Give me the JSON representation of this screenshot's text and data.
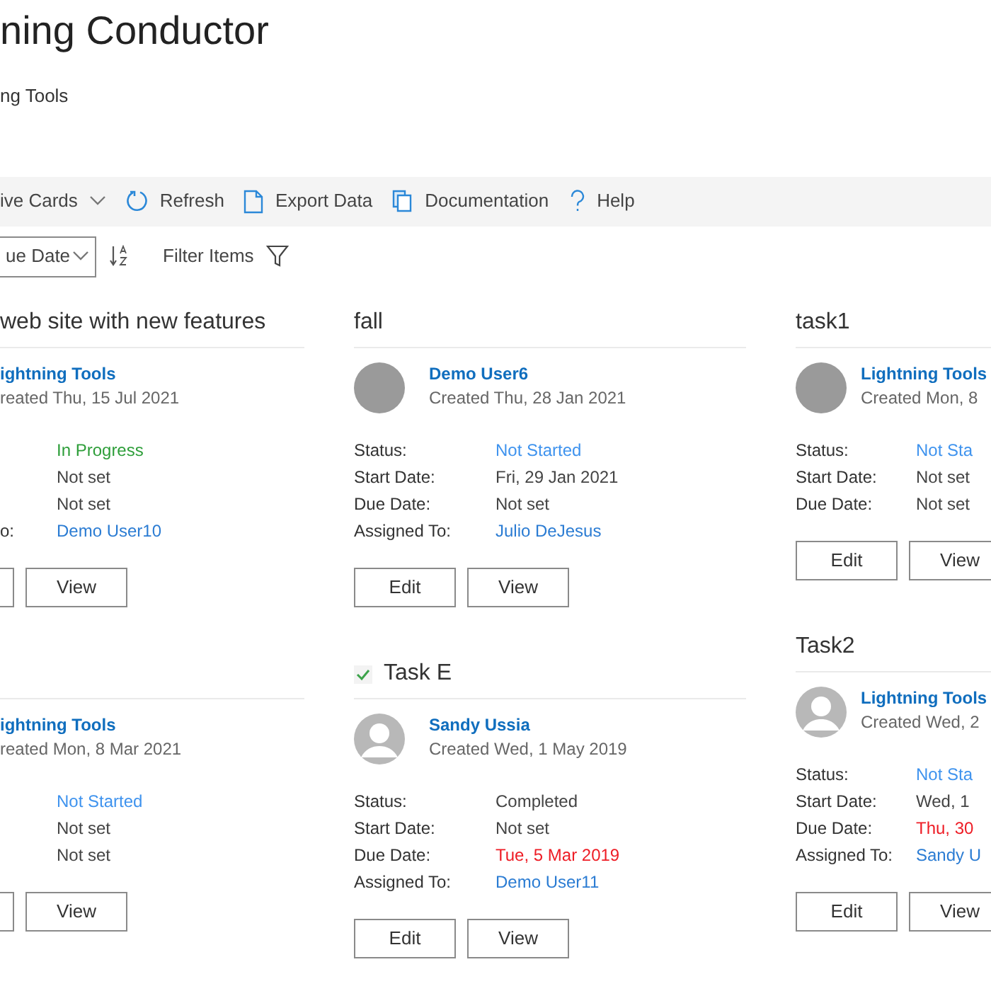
{
  "header": {
    "title": "ning Conductor",
    "subtitle": "ng Tools"
  },
  "toolbar": [
    {
      "kind": "dropdown",
      "label": "ive Cards"
    },
    {
      "kind": "refresh",
      "label": "Refresh"
    },
    {
      "kind": "export",
      "label": "Export Data"
    },
    {
      "kind": "docs",
      "label": "Documentation"
    },
    {
      "kind": "help",
      "label": "Help"
    }
  ],
  "sort": {
    "value": "ue Date"
  },
  "filter": {
    "label": "Filter Items"
  },
  "columns": [
    {
      "cards": [
        {
          "title": "web site with new features",
          "completed": false,
          "name": "ightning Tools",
          "created": "reated Thu, 15 Jul 2021",
          "fields": [
            {
              "value": "In Progress",
              "color": "#2e9e3a"
            },
            {
              "value": "Not set",
              "color": "#444444"
            },
            {
              "value": "Not set",
              "color": "#444444"
            },
            {
              "label": "o:",
              "value": "Demo User10",
              "color": "#2b7cd3"
            }
          ],
          "buttons": [
            {
              "kind": "clipped"
            },
            {
              "kind": "view",
              "label": "View"
            }
          ]
        },
        {
          "completed": false,
          "name": "ightning Tools",
          "created": "reated Mon, 8 Mar 2021",
          "fields": [
            {
              "value": "Not Started",
              "color": "#3f93ee"
            },
            {
              "value": "Not set",
              "color": "#444444"
            },
            {
              "value": "Not set",
              "color": "#444444"
            }
          ],
          "buttons": [
            {
              "kind": "clipped"
            },
            {
              "kind": "view",
              "label": "View"
            }
          ]
        }
      ]
    },
    {
      "cards": [
        {
          "title": "fall",
          "completed": false,
          "avatar": {
            "kind": "photo"
          },
          "name": "Demo User6",
          "created": "Created Thu, 28 Jan 2021",
          "fields": [
            {
              "label": "Status:",
              "value": "Not Started",
              "color": "#3f93ee"
            },
            {
              "label": "Start Date:",
              "value": "Fri, 29 Jan 2021",
              "color": "#444444"
            },
            {
              "label": "Due Date:",
              "value": "Not set",
              "color": "#444444"
            },
            {
              "label": "Assigned To:",
              "value": "Julio DeJesus",
              "color": "#2b7cd3"
            }
          ],
          "buttons": [
            {
              "kind": "edit",
              "label": "Edit"
            },
            {
              "kind": "view",
              "label": "View"
            }
          ]
        },
        {
          "title": "Task E",
          "completed": true,
          "avatar": {
            "kind": "generic"
          },
          "name": "Sandy Ussia",
          "created": "Created Wed, 1 May 2019",
          "fields": [
            {
              "label": "Status:",
              "value": "Completed",
              "color": "#444444"
            },
            {
              "label": "Start Date:",
              "value": "Not set",
              "color": "#444444"
            },
            {
              "label": "Due Date:",
              "value": "Tue, 5 Mar 2019",
              "color": "#ee1c25"
            },
            {
              "label": "Assigned To:",
              "value": "Demo User11",
              "color": "#2b7cd3"
            }
          ],
          "buttons": [
            {
              "kind": "edit",
              "label": "Edit"
            },
            {
              "kind": "view",
              "label": "View"
            }
          ]
        }
      ]
    },
    {
      "cards": [
        {
          "title": "task1",
          "completed": false,
          "avatar": {
            "kind": "photo"
          },
          "name": "Lightning Tools",
          "created": "Created Mon, 8",
          "fields": [
            {
              "label": "Status:",
              "value": "Not Sta",
              "color": "#3f93ee"
            },
            {
              "label": "Start Date:",
              "value": "Not set",
              "color": "#444444"
            },
            {
              "label": "Due Date:",
              "value": "Not set",
              "color": "#444444"
            }
          ],
          "buttons": [
            {
              "kind": "edit",
              "label": "Edit"
            },
            {
              "kind": "view",
              "label": "View"
            }
          ]
        },
        {
          "title": "Task2",
          "completed": false,
          "avatar": {
            "kind": "generic"
          },
          "name": "Lightning Tools",
          "created": "Created Wed, 2",
          "fields": [
            {
              "label": "Status:",
              "value": "Not Sta",
              "color": "#3f93ee"
            },
            {
              "label": "Start Date:",
              "value": "Wed, 1",
              "color": "#444444"
            },
            {
              "label": "Due Date:",
              "value": "Thu, 30",
              "color": "#ee1c25"
            },
            {
              "label": "Assigned To:",
              "value": "Sandy U",
              "color": "#2b7cd3"
            }
          ],
          "buttons": [
            {
              "kind": "edit",
              "label": "Edit"
            },
            {
              "kind": "view",
              "label": "View"
            }
          ]
        }
      ]
    }
  ]
}
